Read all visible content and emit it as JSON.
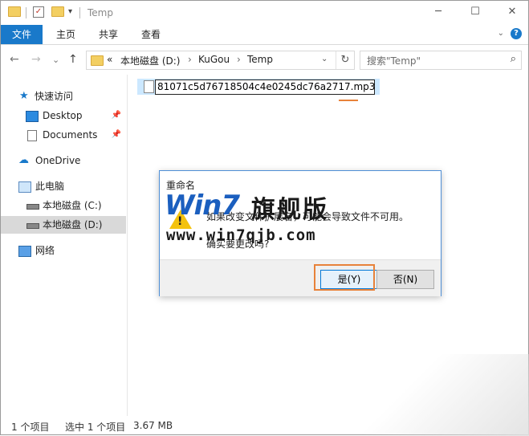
{
  "window": {
    "title": "Temp",
    "controls": {
      "minimize": "─",
      "maximize": "☐",
      "close": "✕"
    }
  },
  "ribbon": {
    "tabs": [
      "文件",
      "主页",
      "共享",
      "查看"
    ],
    "help": "?",
    "collapse": "⌄"
  },
  "address": {
    "back": "←",
    "forward": "→",
    "recent": "⌄",
    "up": "↑",
    "overflow": "«",
    "crumbs": [
      "本地磁盘 (D:)",
      "KuGou",
      "Temp"
    ],
    "separator": "›",
    "dropdown": "⌄",
    "refresh": "↻"
  },
  "search": {
    "placeholder": "搜索\"Temp\""
  },
  "nav_pane": {
    "quick_access": "快速访问",
    "desktop": "Desktop",
    "documents": "Documents",
    "onedrive": "OneDrive",
    "this_pc": "此电脑",
    "drive_c": "本地磁盘 (C:)",
    "drive_d": "本地磁盘 (D:)",
    "network": "网络",
    "pin": "📌"
  },
  "file": {
    "rename_value": "81071c5d76718504c4e0245dc76a2717.mp3"
  },
  "status": {
    "count": "1 个项目",
    "selected": "选中 1 个项目",
    "size": "3.67 MB"
  },
  "dialog": {
    "title": "重命名",
    "message": "如果改变文件扩展名，可能会导致文件不可用。",
    "question": "确实要更改吗?",
    "yes": "是(Y)",
    "no": "否(N)"
  },
  "watermark": {
    "logo": "Win7",
    "name": "旗舰版",
    "url": "www.win7qjb.com"
  },
  "colors": {
    "accent": "#1979ca",
    "selection": "#cce8ff",
    "highlight": "#e8823a"
  }
}
